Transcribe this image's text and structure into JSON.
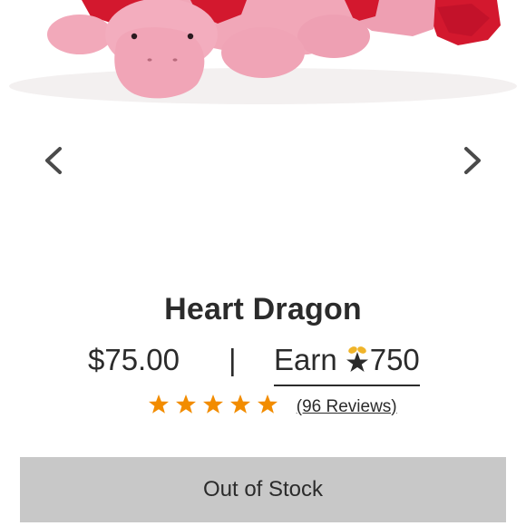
{
  "product": {
    "name": "Heart Dragon",
    "price": "$75.00",
    "price_separator": "|",
    "earn_label": "Earn",
    "reward_points": "750",
    "rating": 5,
    "reviews_label": "(96 Reviews)"
  },
  "carousel": {
    "prev_icon": "chevron-left-icon",
    "next_icon": "chevron-right-icon"
  },
  "actions": {
    "stock_button_label": "Out of Stock"
  },
  "colors": {
    "star": "#f28c00",
    "button_bg": "#c8c8c8",
    "text": "#2b2b2b",
    "plush_pink": "#f0a3b4",
    "plush_red": "#d3182e"
  }
}
